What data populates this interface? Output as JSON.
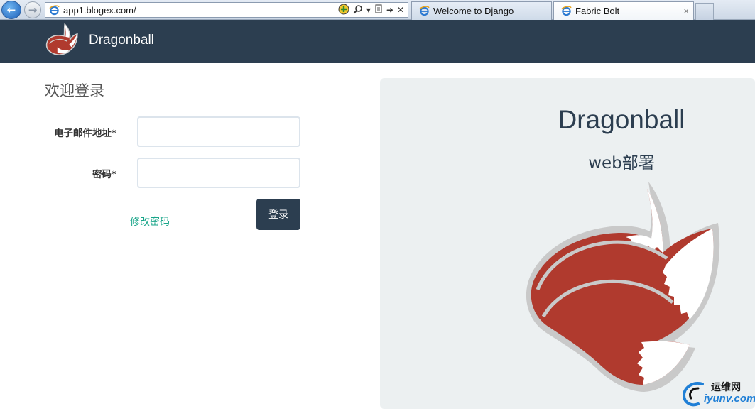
{
  "browser": {
    "url": "app1.blogex.com/",
    "tabs": [
      {
        "label": "Welcome to Django"
      },
      {
        "label": "Fabric Bolt",
        "close": "×"
      }
    ],
    "back_icon": "back-arrow-icon",
    "forward_icon": "forward-arrow-icon"
  },
  "navbar": {
    "brand": "Dragonball"
  },
  "login": {
    "title": "欢迎登录",
    "email_label": "电子邮件地址*",
    "email_value": "",
    "password_label": "密码*",
    "password_value": "",
    "change_password_link": "修改密码",
    "submit_label": "登录"
  },
  "jumbotron": {
    "title": "Dragonball",
    "subtitle": "web部署"
  },
  "watermark": {
    "cn": "运维网",
    "en": "iyunv.com"
  },
  "colors": {
    "navbar": "#2c3e50",
    "link": "#18a589",
    "fox_red": "#b03a2e",
    "jumbotron_bg": "#ecf0f1"
  }
}
